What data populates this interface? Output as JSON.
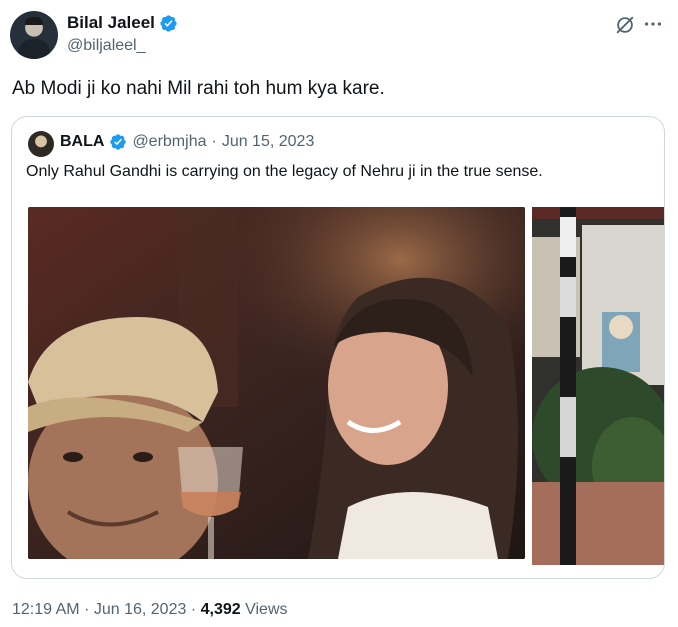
{
  "tweet": {
    "display_name": "Bilal Jaleel",
    "handle": "@biljaleel_",
    "text": "Ab Modi ji ko nahi Mil rahi toh hum kya kare.",
    "avatar_icon": "profile-photo",
    "verified_color": "#1d9bf0"
  },
  "quote": {
    "display_name": "BALA",
    "handle": "@erbmjha",
    "date": "Jun 15, 2023",
    "text": "Only Rahul Gandhi is carrying on the legacy of Nehru ji in the true sense."
  },
  "footer": {
    "time": "12:19 AM",
    "date": "Jun 16, 2023",
    "views_count": "4,392",
    "views_label": "Views"
  },
  "icons": {
    "grok": "grok-icon",
    "more": "more-icon",
    "verified": "verified-badge-icon"
  }
}
